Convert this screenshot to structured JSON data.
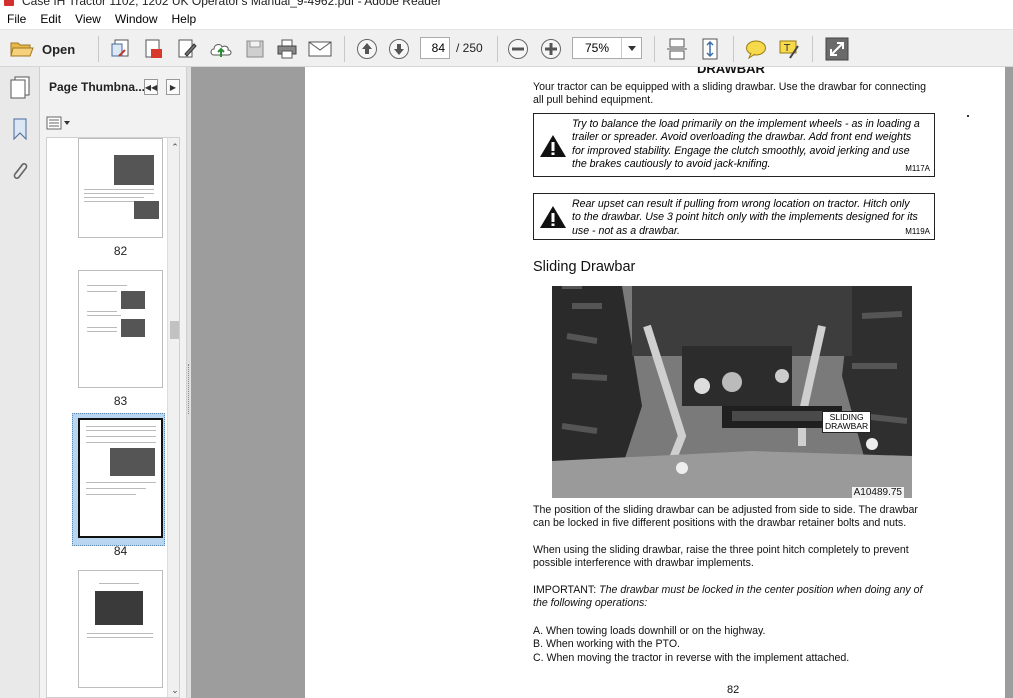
{
  "window": {
    "title": "Case IH Tractor 1102, 1202 UK Operator's Manual_9-4962.pdf - Adobe Reader"
  },
  "menu": [
    "File",
    "Edit",
    "View",
    "Window",
    "Help"
  ],
  "toolbar": {
    "open_label": "Open",
    "current_page": "84",
    "total_pages": "/ 250",
    "zoom": "75%"
  },
  "nav_panel": {
    "title": "Page Thumbna...",
    "thumbnails": [
      {
        "label": "82"
      },
      {
        "label": "83"
      },
      {
        "label": "84",
        "selected": true
      },
      {
        "label": ""
      }
    ]
  },
  "document": {
    "heading_top": "DRAWBAR",
    "intro": [
      "Your tractor can be equipped with a sliding drawbar. Use the drawbar for connecting",
      "all pull behind equipment."
    ],
    "warning1": {
      "lines": [
        "Try to balance the load primarily on the implement wheels - as in loading a",
        "trailer or spreader. Avoid overloading the drawbar. Add front end weights",
        "for improved stability. Engage the clutch smoothly, avoid jerking and use",
        "the brakes cautiously to avoid jack-knifing."
      ],
      "code": "M117A"
    },
    "warning2": {
      "lines": [
        "Rear upset can result if pulling from wrong location on tractor. Hitch only",
        "to the drawbar. Use 3 point hitch only with the implements designed for its",
        "use - not as a drawbar."
      ],
      "code": "M119A"
    },
    "section_title": "Sliding Drawbar",
    "photo_label_1": "SLIDING",
    "photo_label_2": "DRAWBAR",
    "photo_code": "A10489.75",
    "para1": [
      "The position of the sliding drawbar can be adjusted from side to side. The drawbar",
      "can be locked in five different positions with the drawbar retainer bolts and nuts."
    ],
    "para2": [
      "When using the sliding drawbar, raise the three point hitch completely to prevent",
      "possible interference with drawbar implements."
    ],
    "important_label": "IMPORTANT:",
    "important_text_1": "The drawbar must be locked in the center position when doing any of",
    "important_text_2": "the following operations:",
    "list": [
      "A.  When towing loads downhill or on the highway.",
      "B.  When working with the PTO.",
      "C.  When moving the tractor in reverse with the implement attached."
    ],
    "page_number": "82"
  }
}
